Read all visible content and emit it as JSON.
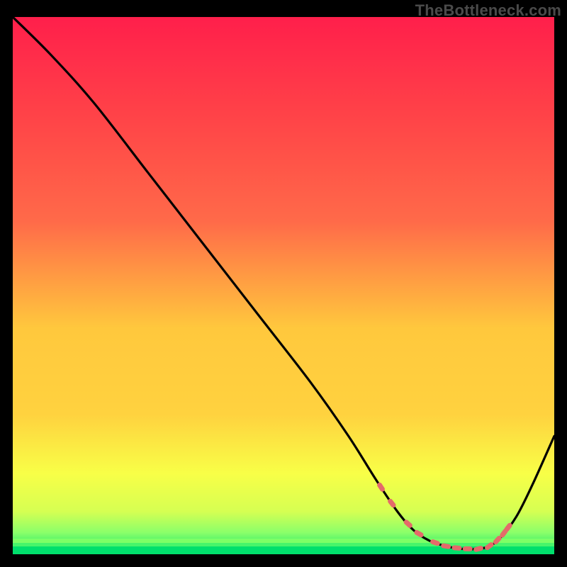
{
  "watermark": "TheBottleneck.com",
  "colors": {
    "bg": "#000000",
    "grad_top": "#ff1f4b",
    "grad_upper": "#ff6a49",
    "grad_mid": "#ffd23f",
    "grad_low1": "#f8ff47",
    "grad_low2": "#d6ff52",
    "grad_low3": "#8aff6a",
    "grad_bottom": "#00e06a",
    "curve": "#000000",
    "dash": "#e46a6a"
  },
  "chart_data": {
    "type": "line",
    "title": "",
    "xlabel": "",
    "ylabel": "",
    "xlim": [
      0,
      100
    ],
    "ylim": [
      0,
      100
    ],
    "series": [
      {
        "name": "bottleneck-curve",
        "x": [
          0,
          7,
          15,
          25,
          35,
          45,
          55,
          62,
          67,
          71,
          74,
          77,
          80,
          83,
          86,
          88,
          90,
          93,
          96,
          100
        ],
        "y": [
          100,
          93,
          84,
          71,
          58,
          45,
          32,
          22,
          14,
          8,
          4.5,
          2.5,
          1.5,
          1,
          1,
          1.5,
          3,
          7,
          13,
          22
        ]
      }
    ],
    "flat_region": {
      "x_start": 68,
      "x_end": 91
    },
    "dash_points_x": [
      68,
      70,
      73,
      75,
      78,
      80,
      82,
      84,
      86,
      88,
      89.5,
      90.7,
      91.5
    ]
  }
}
